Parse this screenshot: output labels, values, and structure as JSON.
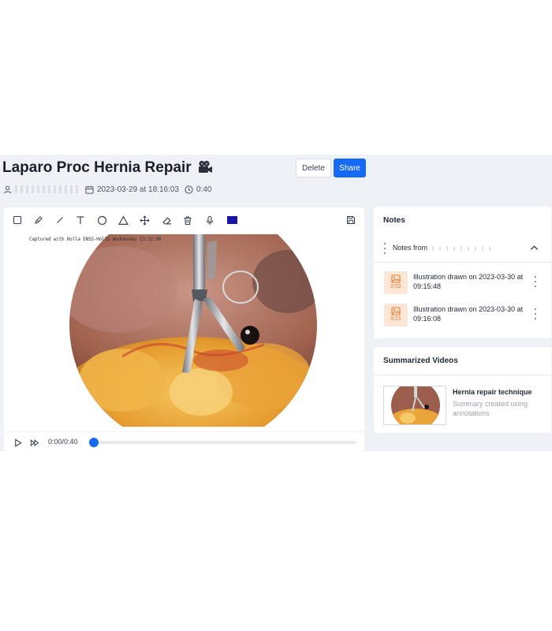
{
  "header": {
    "title": "Laparo Proc Hernia Repair",
    "delete_label": "Delete",
    "share_label": "Share"
  },
  "meta": {
    "date": "2023-03-29 at 18:16:03",
    "duration": "0:40"
  },
  "video": {
    "overlay_text": "Captured with Holla ENSS-Hollo Wednesday 13:12:00"
  },
  "player": {
    "time": "0:00/0:40",
    "progress": 0
  },
  "notes": {
    "title": "Notes",
    "group_label": "Notes from",
    "items": [
      {
        "time": "0:02",
        "text": "Illustration drawn on 2023-03-30 at 09:15:48"
      },
      {
        "time": "0:21",
        "text": "Illustration drawn on 2023-03-30 at 09:16:08"
      }
    ]
  },
  "summarized": {
    "title": "Summarized Videos",
    "items": [
      {
        "title": "Hernia repair technique",
        "description": "Summary created using annotations"
      }
    ]
  },
  "colors": {
    "accent": "#1669f2",
    "pen_color": "#1a13a8",
    "badge_bg": "#fde6d6",
    "badge_fg": "#e8751e"
  },
  "icons": [
    "user-icon",
    "calendar-icon",
    "clock-icon",
    "rectangle-tool-icon",
    "pen-tool-icon",
    "line-tool-icon",
    "text-tool-icon",
    "circle-tool-icon",
    "triangle-tool-icon",
    "move-tool-icon",
    "eraser-tool-icon",
    "trash-icon",
    "microphone-icon",
    "save-icon",
    "play-icon",
    "fast-forward-icon",
    "image-icon",
    "chevron-up-icon",
    "kebab-menu-icon",
    "video-camera-icon"
  ]
}
